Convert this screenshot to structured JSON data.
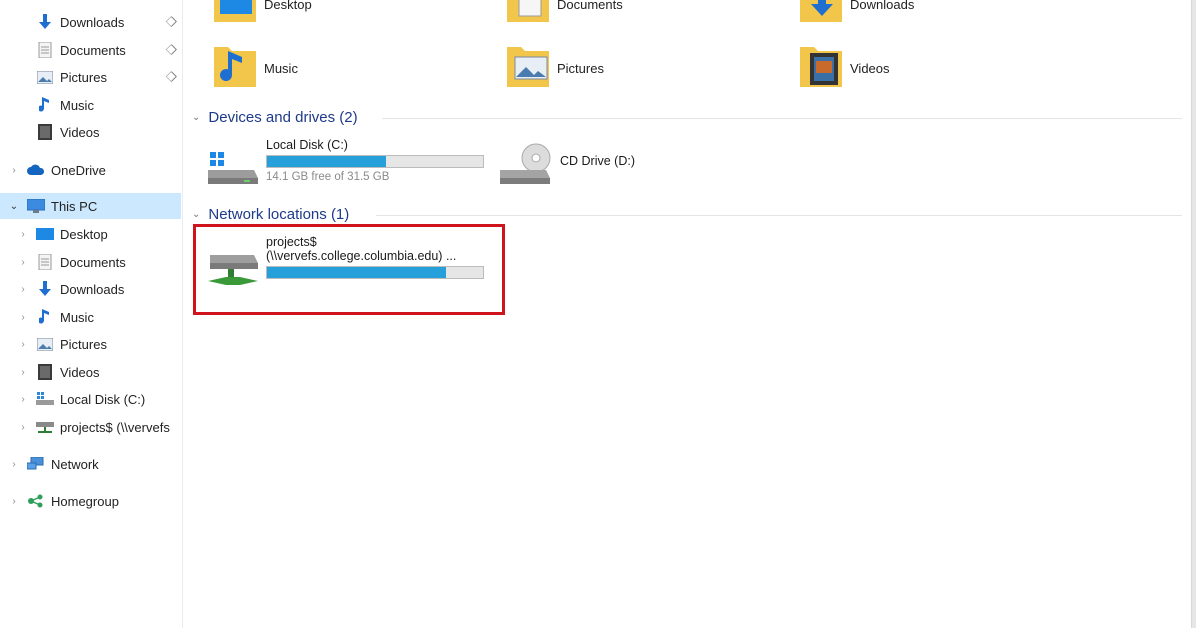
{
  "nav": {
    "quick_access": [
      {
        "label": "Downloads",
        "icon": "download-arrow-icon",
        "pinned": true
      },
      {
        "label": "Documents",
        "icon": "documents-icon",
        "pinned": true
      },
      {
        "label": "Pictures",
        "icon": "pictures-icon",
        "pinned": true
      },
      {
        "label": "Music",
        "icon": "music-note-icon",
        "pinned": false
      },
      {
        "label": "Videos",
        "icon": "videos-icon",
        "pinned": false
      }
    ],
    "onedrive": "OneDrive",
    "this_pc": "This PC",
    "this_pc_children": [
      {
        "label": "Desktop",
        "icon": "desktop-icon"
      },
      {
        "label": "Documents",
        "icon": "documents-icon"
      },
      {
        "label": "Downloads",
        "icon": "download-arrow-icon"
      },
      {
        "label": "Music",
        "icon": "music-note-icon"
      },
      {
        "label": "Pictures",
        "icon": "pictures-icon"
      },
      {
        "label": "Videos",
        "icon": "videos-icon"
      },
      {
        "label": "Local Disk (C:)",
        "icon": "local-disk-icon"
      },
      {
        "label": "projects$ (\\\\vervefs",
        "icon": "network-drive-icon"
      }
    ],
    "network": "Network",
    "homegroup": "Homegroup"
  },
  "folders": {
    "desktop": "Desktop",
    "documents": "Documents",
    "downloads": "Downloads",
    "music": "Music",
    "pictures": "Pictures",
    "videos": "Videos"
  },
  "devices": {
    "header": "Devices and drives (2)",
    "local_disk": {
      "name": "Local Disk (C:)",
      "free": "14.1 GB free of 31.5 GB",
      "used_fraction": 0.55
    },
    "cd_drive": {
      "name": "CD Drive (D:)"
    }
  },
  "network_locations": {
    "header": "Network locations (1)",
    "projects": {
      "name": "projects$",
      "path": "(\\\\vervefs.college.columbia.edu) ...",
      "used_fraction": 0.83
    }
  },
  "colors": {
    "accent": "#26a0da",
    "selection": "#cce8ff",
    "highlight": "#d0141e",
    "group_header": "#1e3a8a"
  }
}
